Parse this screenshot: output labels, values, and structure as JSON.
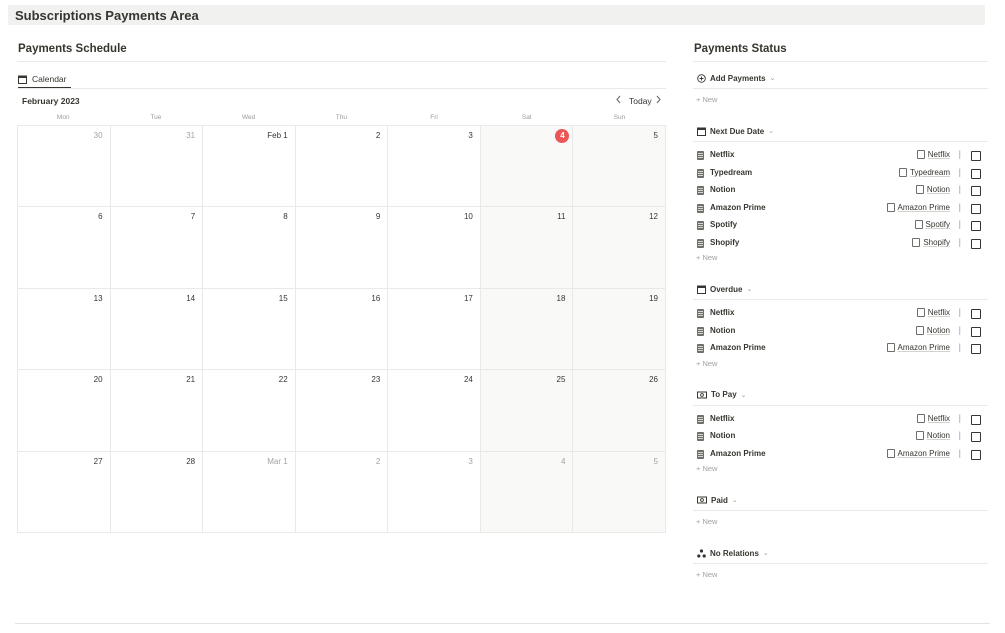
{
  "page": {
    "title": "Subscriptions Payments Area"
  },
  "schedule": {
    "title": "Payments Schedule",
    "view_tab": "Calendar",
    "month": "February 2023",
    "today_label": "Today",
    "weekdays": [
      "Mon",
      "Tue",
      "Wed",
      "Thu",
      "Fri",
      "Sat",
      "Sun"
    ],
    "days": [
      {
        "label": "30",
        "muted": true
      },
      {
        "label": "31",
        "muted": true
      },
      {
        "label": "Feb 1"
      },
      {
        "label": "2"
      },
      {
        "label": "3"
      },
      {
        "label": "4",
        "today": true
      },
      {
        "label": "5"
      },
      {
        "label": "6"
      },
      {
        "label": "7"
      },
      {
        "label": "8"
      },
      {
        "label": "9"
      },
      {
        "label": "10"
      },
      {
        "label": "11"
      },
      {
        "label": "12"
      },
      {
        "label": "13"
      },
      {
        "label": "14"
      },
      {
        "label": "15"
      },
      {
        "label": "16"
      },
      {
        "label": "17"
      },
      {
        "label": "18"
      },
      {
        "label": "19"
      },
      {
        "label": "20"
      },
      {
        "label": "21"
      },
      {
        "label": "22"
      },
      {
        "label": "23"
      },
      {
        "label": "24"
      },
      {
        "label": "25"
      },
      {
        "label": "26"
      },
      {
        "label": "27"
      },
      {
        "label": "28"
      },
      {
        "label": "Mar 1",
        "muted": true
      },
      {
        "label": "2",
        "muted": true
      },
      {
        "label": "3",
        "muted": true
      },
      {
        "label": "4",
        "muted": true
      },
      {
        "label": "5",
        "muted": true
      }
    ]
  },
  "status": {
    "title": "Payments Status",
    "new_label": "+ New",
    "groups": [
      {
        "key": "add-payments",
        "label": "Add Payments",
        "icon": "plus-circle-icon",
        "items": []
      },
      {
        "key": "next-due-date",
        "label": "Next Due Date",
        "icon": "calendar-icon",
        "items": [
          {
            "name": "Netflix",
            "relation": "Netflix"
          },
          {
            "name": "Typedream",
            "relation": "Typedream"
          },
          {
            "name": "Notion",
            "relation": "Notion"
          },
          {
            "name": "Amazon Prime",
            "relation": "Amazon Prime"
          },
          {
            "name": "Spotify",
            "relation": "Spotify"
          },
          {
            "name": "Shopify",
            "relation": "Shopify"
          }
        ]
      },
      {
        "key": "overdue",
        "label": "Overdue",
        "icon": "calendar-icon",
        "items": [
          {
            "name": "Netflix",
            "relation": "Netflix"
          },
          {
            "name": "Notion",
            "relation": "Notion"
          },
          {
            "name": "Amazon Prime",
            "relation": "Amazon Prime"
          }
        ]
      },
      {
        "key": "to-pay",
        "label": "To Pay",
        "icon": "money-icon",
        "items": [
          {
            "name": "Netflix",
            "relation": "Netflix"
          },
          {
            "name": "Notion",
            "relation": "Notion"
          },
          {
            "name": "Amazon Prime",
            "relation": "Amazon Prime"
          }
        ]
      },
      {
        "key": "paid",
        "label": "Paid",
        "icon": "money-icon",
        "items": []
      },
      {
        "key": "no-relations",
        "label": "No Relations",
        "icon": "relations-icon",
        "items": []
      }
    ]
  },
  "colors": {
    "accent_today": "#eb5757",
    "text": "#37352f",
    "muted": "#9b9a97"
  }
}
